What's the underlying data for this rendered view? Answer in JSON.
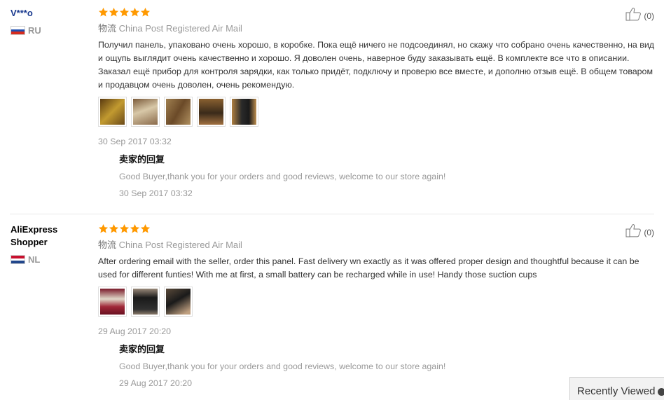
{
  "reviews": [
    {
      "user": "V***o",
      "country": "RU",
      "flag_colors": [
        "#ffffff",
        "#1f4fb0",
        "#d52b1e"
      ],
      "rating": 5,
      "shipping_label": "物流",
      "shipping_method": "China Post Registered Air Mail",
      "text": "Получил панель, упаковано очень хорошо, в коробке. Пока ещё ничего не подсоединял, но скажу что собрано очень качественно, на вид и ощупь выглядит очень качественно и хорошо. Я доволен очень, наверное буду заказывать ещё. В комплекте все что в описании. Заказал ещё прибор для контроля зарядки, как только придёт, подключу и проверю все вместе, и дополню отзыв ещё. В общем товаром и продавцом очень доволен, очень рекомендую.",
      "photo_colors": [
        "#8a6a1f",
        "#a58a66",
        "#8c6b3f",
        "#6b4a2a",
        "#3a2e26"
      ],
      "date": "30 Sep 2017 03:32",
      "reply_title": "卖家的回复",
      "reply_text": "Good Buyer,thank you for your orders and good reviews, welcome to our store again!",
      "reply_date": "30 Sep 2017 03:32",
      "likes": "(0)"
    },
    {
      "user_line1": "AliExpress",
      "user_line2": "Shopper",
      "country": "NL",
      "flag_colors": [
        "#c8102e",
        "#ffffff",
        "#21468b"
      ],
      "rating": 5,
      "shipping_label": "物流",
      "shipping_method": "China Post Registered Air Mail",
      "text": "After ordering email with the seller, order this panel. Fast delivery wn exactly as it was offered proper design and thoughtful because it can be used for different funties! With me at first, a small battery can be recharged while in use! Handy those suction cups",
      "photo_colors": [
        "#9a3040",
        "#3a3a3a",
        "#2a2a2a"
      ],
      "date": "29 Aug 2017 20:20",
      "reply_title": "卖家的回复",
      "reply_text": "Good Buyer,thank you for your orders and good reviews, welcome to our store again!",
      "reply_date": "29 Aug 2017 20:20",
      "likes": "(0)"
    }
  ],
  "recently_viewed": "Recently Viewed",
  "colors": {
    "star": "#ff9900",
    "accent_blue": "#1a3a8f"
  }
}
